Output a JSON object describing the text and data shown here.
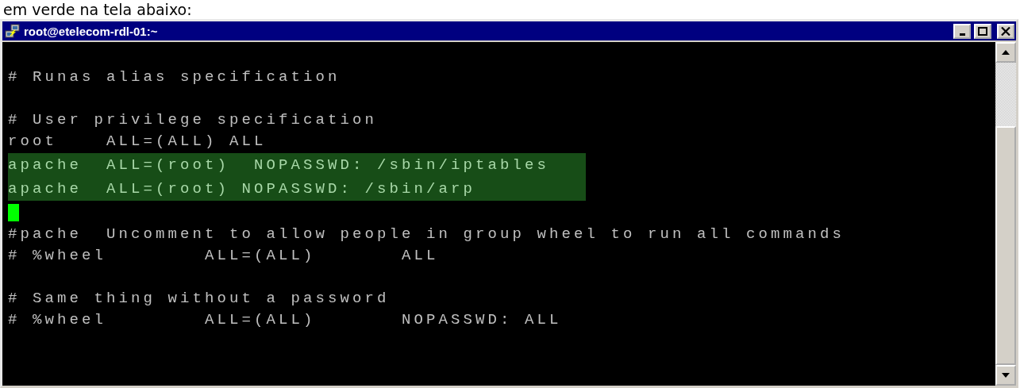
{
  "caption": "em verde na tela abaixo:",
  "window": {
    "title": "root@etelecom-rdl-01:~"
  },
  "title_buttons": [
    {
      "kind": "minimize"
    },
    {
      "kind": "maximize"
    },
    {
      "kind": "close"
    }
  ],
  "terminal": {
    "lines": [
      {
        "kind": "blank"
      },
      {
        "kind": "text",
        "text": "# Runas alias specification",
        "highlighted": false
      },
      {
        "kind": "blank"
      },
      {
        "kind": "text",
        "text": "# User privilege specification",
        "highlighted": false
      },
      {
        "kind": "text",
        "text": "root    ALL=(ALL) ALL",
        "highlighted": false
      },
      {
        "kind": "text",
        "text": "apache  ALL=(root)  NOPASSWD: /sbin/iptables",
        "highlighted": true
      },
      {
        "kind": "text",
        "text": "apache  ALL=(root) NOPASSWD: /sbin/arp",
        "highlighted": true
      },
      {
        "kind": "cursor"
      },
      {
        "kind": "text",
        "text": "#pache  Uncomment to allow people in group wheel to run all commands",
        "highlighted": false
      },
      {
        "kind": "text",
        "text": "# %wheel        ALL=(ALL)       ALL",
        "highlighted": false
      },
      {
        "kind": "blank"
      },
      {
        "kind": "text",
        "text": "# Same thing without a password",
        "highlighted": false
      },
      {
        "kind": "text",
        "text": "# %wheel        ALL=(ALL)       NOPASSWD: ALL",
        "highlighted": false
      }
    ]
  }
}
